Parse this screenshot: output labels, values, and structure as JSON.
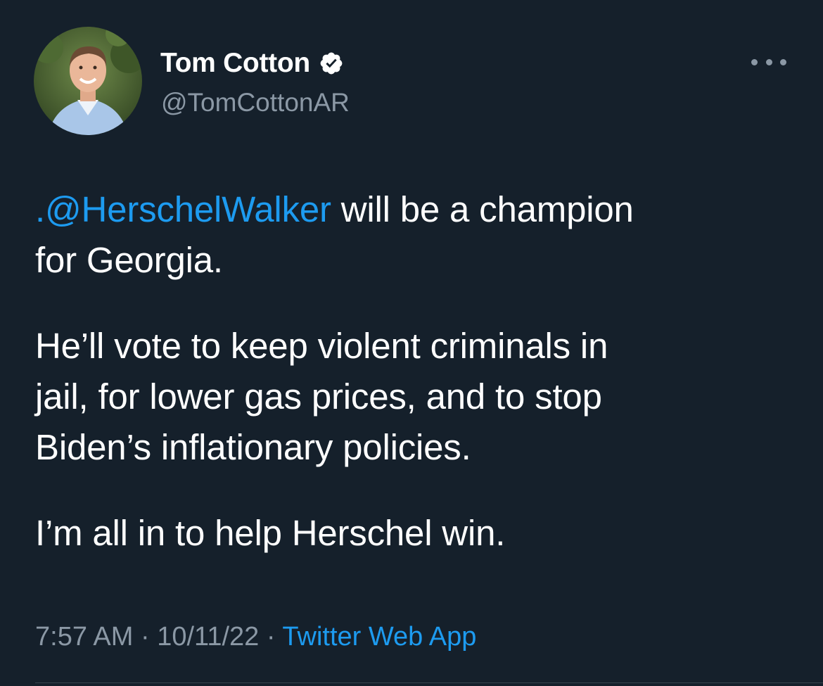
{
  "author": {
    "display_name": "Tom Cotton",
    "handle": "@TomCottonAR",
    "verified": true
  },
  "tweet": {
    "paragraph1": {
      "mention": ".@HerschelWalker",
      "rest_line1": " will be a champion",
      "line2": "for Georgia."
    },
    "paragraph2": {
      "line1": "He’ll vote to keep violent criminals in",
      "line2": "jail, for lower gas prices, and to stop",
      "line3": "Biden’s inflationary policies."
    },
    "paragraph3": {
      "line1": "I’m all in to help Herschel win."
    }
  },
  "meta": {
    "time": "7:57 AM",
    "separator": " · ",
    "date": "10/11/22",
    "source": "Twitter Web App"
  },
  "icons": {
    "verified": "verified-badge-icon",
    "more": "more-horizontal-icon"
  },
  "colors": {
    "background": "#15202b",
    "text": "#ffffff",
    "secondary": "#8b98a5",
    "link": "#1d9bf0"
  }
}
